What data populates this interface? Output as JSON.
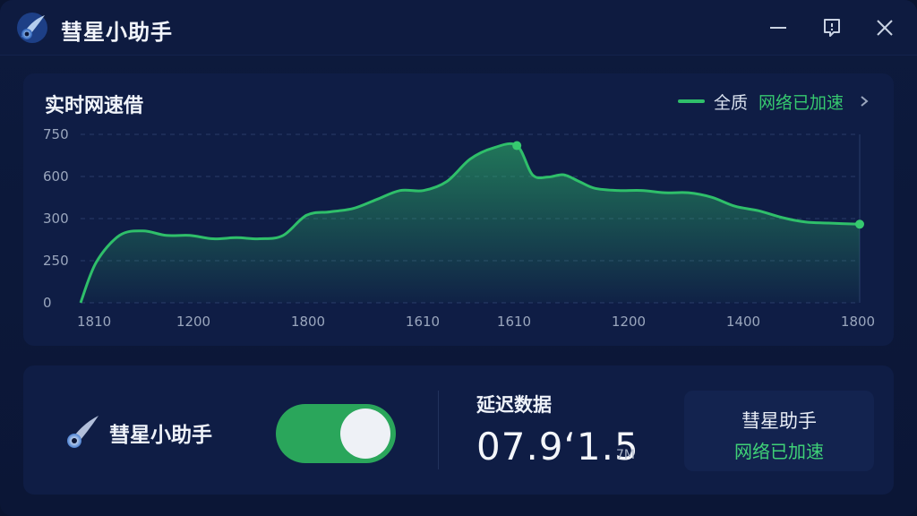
{
  "window": {
    "title": "彗星小助手"
  },
  "titlebar": {
    "minimize_icon": "minimize-icon",
    "feedback_icon": "feedback-icon",
    "close_icon": "close-icon"
  },
  "chart": {
    "title": "实时网速借",
    "legend_label": "全质",
    "legend_status": "网络已加速",
    "accent_color": "#2fbf6a"
  },
  "chart_data": {
    "type": "area",
    "title": "实时网速借",
    "y_ticks": [
      "750",
      "600",
      "300",
      "250",
      "0"
    ],
    "x_ticks": [
      "1810",
      "1200",
      "1800",
      "1610",
      "1610",
      "1200",
      "1400",
      "1800"
    ],
    "grid": true,
    "series": [
      {
        "name": "全质",
        "x": [
          0,
          0.02,
          0.05,
          0.08,
          0.11,
          0.14,
          0.17,
          0.2,
          0.23,
          0.26,
          0.29,
          0.32,
          0.35,
          0.38,
          0.41,
          0.44,
          0.47,
          0.5,
          0.53,
          0.56,
          0.58,
          0.6,
          0.62,
          0.64,
          0.66,
          0.69,
          0.72,
          0.75,
          0.78,
          0.81,
          0.84,
          0.87,
          0.9,
          0.93,
          0.96,
          1.0
        ],
        "values": [
          0,
          180,
          300,
          320,
          300,
          300,
          285,
          290,
          285,
          300,
          390,
          405,
          420,
          460,
          500,
          500,
          540,
          640,
          690,
          700,
          570,
          560,
          570,
          540,
          510,
          500,
          500,
          490,
          490,
          470,
          430,
          410,
          380,
          360,
          355,
          350
        ]
      }
    ]
  },
  "bottom": {
    "app_name": "彗星小助手",
    "toggle_on": true,
    "latency_label": "延迟数据",
    "latency_value": "07.9‘1.5",
    "latency_unit": "7M",
    "status_name": "彗星助手",
    "status_text": "网络已加速"
  }
}
